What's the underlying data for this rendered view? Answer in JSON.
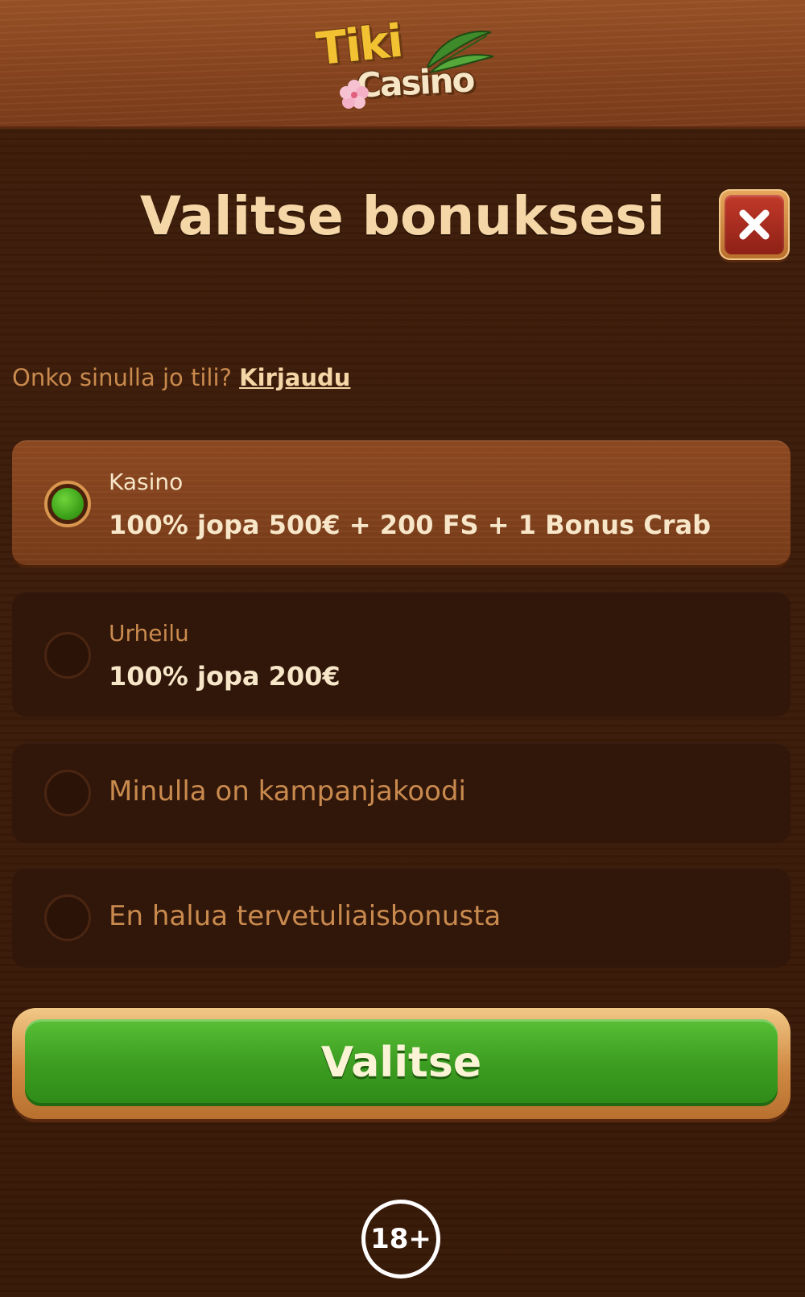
{
  "header": {
    "logo_top": "Tiki",
    "logo_bottom": "Casino"
  },
  "modal": {
    "title": "Valitse bonuksesi",
    "login_prompt": "Onko sinulla jo tili?",
    "login_link": "Kirjaudu"
  },
  "options": [
    {
      "label": "Kasino",
      "value": "100% jopa 500€ + 200 FS + 1 Bonus Crab",
      "selected": true
    },
    {
      "label": "Urheilu",
      "value": "100% jopa 200€",
      "selected": false
    },
    {
      "label": "Minulla on kampanjakoodi",
      "selected": false
    },
    {
      "label": "En halua tervetuliaisbonusta",
      "selected": false
    }
  ],
  "actions": {
    "choose_label": "Valitse"
  },
  "footer": {
    "age_badge": "18+"
  },
  "icons": {
    "close": "close-icon",
    "selected_radio": "radio-checked-icon",
    "unselected_radio": "radio-unchecked-icon"
  },
  "colors": {
    "background": "#3a1a08",
    "header_wood": "#8a4620",
    "title_text": "#f5d6a6",
    "muted_text": "#c98a4e",
    "selected_option": "#8f4a22",
    "unselected_option": "#31160a",
    "radio_active": "#3ea21a",
    "button_green": "#3d9e22",
    "button_frame": "#d08a44",
    "close_red": "#c23a2a"
  }
}
